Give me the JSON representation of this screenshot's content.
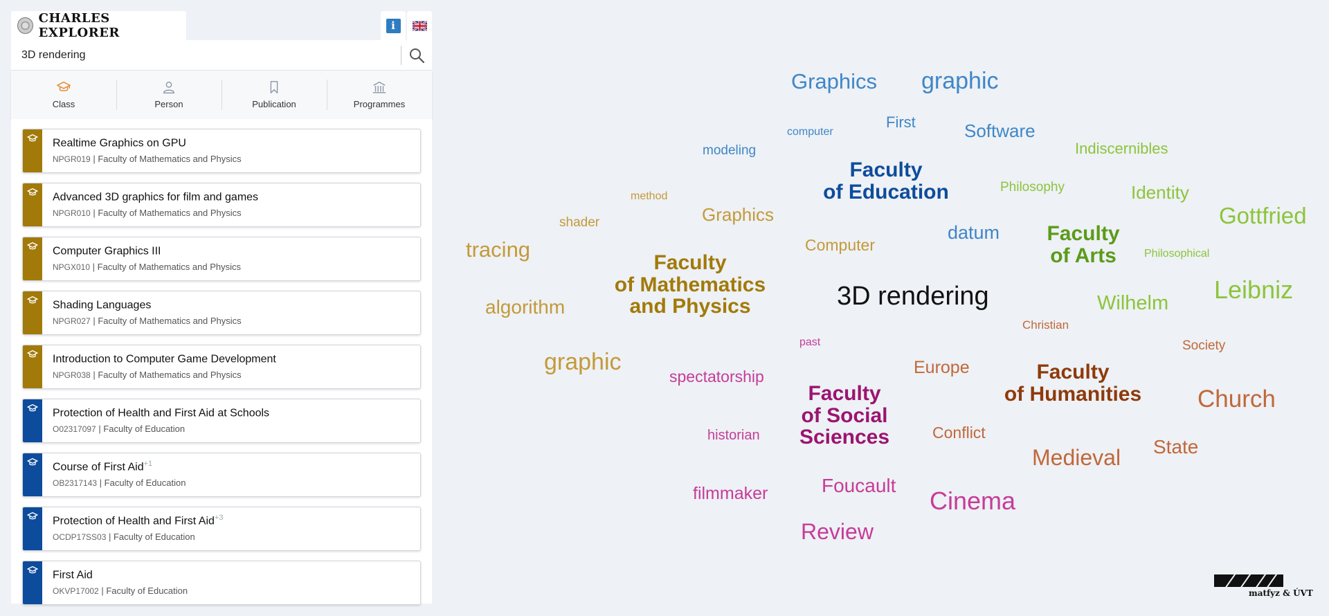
{
  "app": {
    "logo_text": "CHARLES EXPLORER",
    "info_label": "i"
  },
  "search": {
    "value": "3D rendering",
    "placeholder": ""
  },
  "tabs": [
    {
      "label": "Class",
      "icon": "graduation-cap-icon",
      "active": true
    },
    {
      "label": "Person",
      "icon": "person-icon",
      "active": false
    },
    {
      "label": "Publication",
      "icon": "bookmark-icon",
      "active": false
    },
    {
      "label": "Programmes",
      "icon": "building-icon",
      "active": false
    }
  ],
  "colors": {
    "accent": "#e8892f",
    "math_physics": "#a27a0a",
    "education": "#0d4c9c",
    "arts": "#5b9b1a",
    "social": "#9b1470",
    "humanities": "#8e3a0c",
    "math_light": "#c39a3a",
    "edu_light": "#3f86c8",
    "arts_light": "#8cc43c",
    "social_light": "#c63c9a",
    "hum_light": "#c0683a"
  },
  "results": [
    {
      "title": "Realtime Graphics on GPU",
      "sup": "",
      "code": "NPGR019",
      "faculty": "Faculty of Mathematics and Physics",
      "color": "#a27a0a"
    },
    {
      "title": "Advanced 3D graphics for film and games",
      "sup": "",
      "code": "NPGR010",
      "faculty": "Faculty of Mathematics and Physics",
      "color": "#a27a0a"
    },
    {
      "title": "Computer Graphics III",
      "sup": "",
      "code": "NPGX010",
      "faculty": "Faculty of Mathematics and Physics",
      "color": "#a27a0a"
    },
    {
      "title": "Shading Languages",
      "sup": "",
      "code": "NPGR027",
      "faculty": "Faculty of Mathematics and Physics",
      "color": "#a27a0a"
    },
    {
      "title": "Introduction to Computer Game Development",
      "sup": "",
      "code": "NPGR038",
      "faculty": "Faculty of Mathematics and Physics",
      "color": "#a27a0a"
    },
    {
      "title": "Protection of Health and First Aid at Schools",
      "sup": "",
      "code": "O02317097",
      "faculty": "Faculty of Education",
      "color": "#0d4c9c"
    },
    {
      "title": "Course of First Aid",
      "sup": "+1",
      "code": "OB2317143",
      "faculty": "Faculty of Education",
      "color": "#0d4c9c"
    },
    {
      "title": "Protection of Health and First Aid",
      "sup": "+3",
      "code": "OCDP17SS03",
      "faculty": "Faculty of Education",
      "color": "#0d4c9c"
    },
    {
      "title": "First Aid",
      "sup": "",
      "code": "OKVP17002",
      "faculty": "Faculty of Education",
      "color": "#0d4c9c"
    }
  ],
  "cloud": {
    "center": "3D rendering",
    "faculties": {
      "math": [
        "Faculty",
        "of Mathematics",
        "and Physics"
      ],
      "education": [
        "Faculty",
        "of Education"
      ],
      "arts": [
        "Faculty",
        "of Arts"
      ],
      "social": [
        "Faculty",
        "of Social",
        "Sciences"
      ],
      "humanities": [
        "Faculty",
        "of Humanities"
      ]
    },
    "words": {
      "graphics_top": "Graphics",
      "graphic_top": "graphic",
      "computer_small": "computer",
      "first": "First",
      "software": "Software",
      "modeling": "modeling",
      "datum": "datum",
      "indiscernibles": "Indiscernibles",
      "philosophy": "Philosophy",
      "identity": "Identity",
      "gottfried": "Gottfried",
      "philosophical": "Philosophical",
      "leibniz": "Leibniz",
      "wilhelm": "Wilhelm",
      "method": "method",
      "shader": "shader",
      "graphics_mid": "Graphics",
      "tracing": "tracing",
      "computer_mid": "Computer",
      "algorithm": "algorithm",
      "graphic_low": "graphic",
      "christian": "Christian",
      "past": "past",
      "society": "Society",
      "spectatorship": "spectatorship",
      "europe": "Europe",
      "church": "Church",
      "historian": "historian",
      "conflict": "Conflict",
      "state": "State",
      "medieval": "Medieval",
      "filmmaker": "filmmaker",
      "foucault": "Foucault",
      "cinema": "Cinema",
      "review": "Review"
    }
  },
  "footer": {
    "caption": "matfyz & ÚVT"
  }
}
